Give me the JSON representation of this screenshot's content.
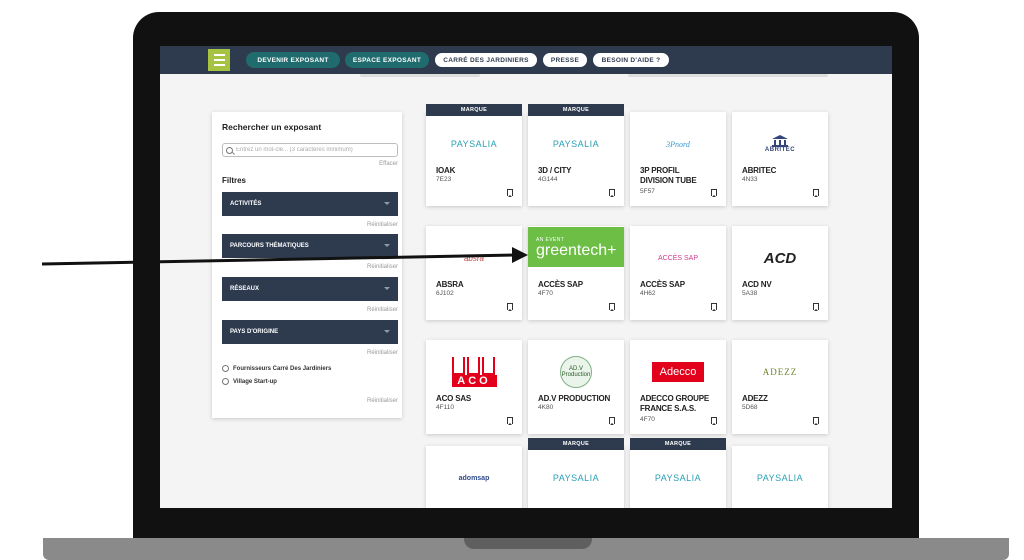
{
  "nav": {
    "buttons": [
      "DEVENIR EXPOSANT",
      "ESPACE EXPOSANT",
      "CARRÉ DES JARDINIERS",
      "PRESSE",
      "BESOIN D'AIDE ?"
    ]
  },
  "sidebar": {
    "title": "Rechercher un exposant",
    "search_placeholder": "Entrez un mot-clé... (3 caractères minimum)",
    "clear_label": "Effacer",
    "filters_title": "Filtres",
    "reset_label": "Réinitialiser",
    "filters": [
      "ACTIVITÉS",
      "PARCOURS THÉMATIQUES",
      "RÉSEAUX",
      "PAYS D'ORIGINE"
    ],
    "checkboxes": [
      "Fournisseurs Carré Des Jardiniers",
      "Village Start-up"
    ]
  },
  "cards": [
    {
      "tag": "MARQUE",
      "logo_text": "PAYSALIA",
      "name": "IOAK",
      "stand": "7E23"
    },
    {
      "tag": "MARQUE",
      "logo_text": "PAYSALIA",
      "name": "3D / CITY",
      "stand": "4G144"
    },
    {
      "tag": "",
      "logo_text": "3Pnord",
      "name": "3P PROFIL DIVISION TUBE",
      "stand": "5F57"
    },
    {
      "tag": "",
      "logo_text": "ABRITEC",
      "name": "ABRITEC",
      "stand": "4N33"
    },
    {
      "tag": "",
      "logo_text": "absra",
      "name": "ABSRA",
      "stand": "6J102"
    },
    {
      "tag": "",
      "logo_text_small": "AN EVENT",
      "logo_text": "greentech+",
      "name": "ACCÈS SAP",
      "stand": "4F70"
    },
    {
      "tag": "",
      "logo_text": "ACCÈS SAP",
      "name": "ACCÈS SAP",
      "stand": "4H62"
    },
    {
      "tag": "",
      "logo_text": "ACD",
      "name": "ACD NV",
      "stand": "5A38"
    },
    {
      "tag": "",
      "logo_text": "ACO",
      "name": "ACO SAS",
      "stand": "4F110"
    },
    {
      "tag": "",
      "logo_text": "AD.V Production",
      "name": "AD.V PRODUCTION",
      "stand": "4K80"
    },
    {
      "tag": "",
      "logo_text": "Adecco",
      "name": "ADECCO GROUPE FRANCE S.A.S.",
      "stand": "4F70"
    },
    {
      "tag": "",
      "logo_text": "ADEZZ",
      "name": "ADEZZ",
      "stand": "5D68"
    },
    {
      "tag": "",
      "logo_text": "adomsap",
      "name": "",
      "stand": ""
    },
    {
      "tag": "MARQUE",
      "logo_text": "PAYSALIA",
      "name": "",
      "stand": ""
    },
    {
      "tag": "MARQUE",
      "logo_text": "PAYSALIA",
      "name": "",
      "stand": ""
    },
    {
      "tag": "",
      "logo_text": "PAYSALIA",
      "name": "",
      "stand": ""
    }
  ]
}
